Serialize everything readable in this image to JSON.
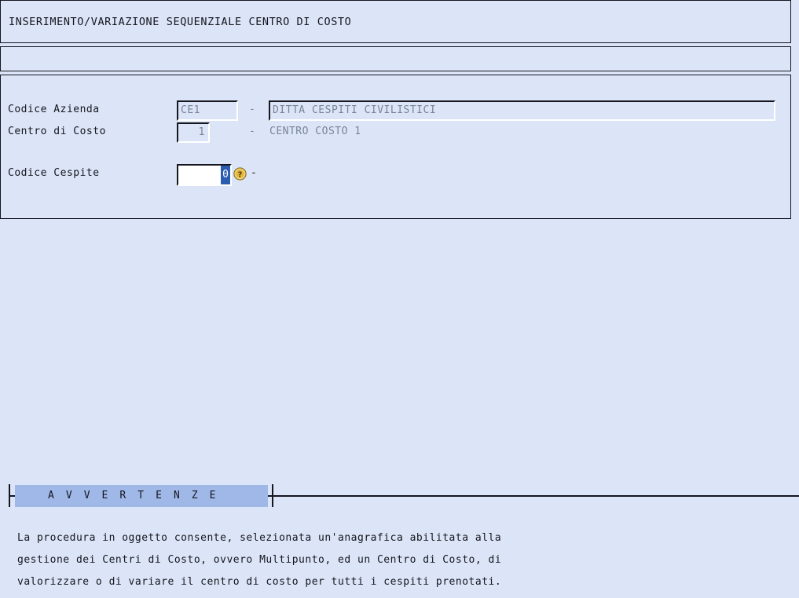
{
  "window": {
    "title": "INSERIMENTO/VARIAZIONE SEQUENZIALE CENTRO DI COSTO"
  },
  "form": {
    "azienda": {
      "label": "Codice Azienda",
      "code": "CE1",
      "separator": "-",
      "description": "DITTA CESPITI CIVILISTICI"
    },
    "centro_costo": {
      "label": "Centro di Costo",
      "code": "1",
      "separator": "-",
      "description": "CENTRO COSTO 1"
    },
    "cespite": {
      "label": "Codice Cespite",
      "value": "0",
      "placeholder": "0",
      "separator": "-",
      "help_icon": "help-question-icon"
    }
  },
  "notes": {
    "legend": "A V V E R T E N Z E",
    "lines": [
      "La procedura in oggetto consente, selezionata un'anagrafica abilitata alla",
      "gestione dei Centri di Costo, ovvero Multipunto, ed un Centro di Costo, di",
      "valorizzare o di variare il centro di costo per tutti i cespiti prenotati."
    ]
  },
  "colors": {
    "page_background": "#dbe5f7",
    "panel_border": "#15161e",
    "legend_background": "#a0b8e8",
    "selection_background": "#2a5db0",
    "readonly_text": "#7a8499",
    "text": "#15161e",
    "help_icon_gold": "#e8c14a"
  }
}
